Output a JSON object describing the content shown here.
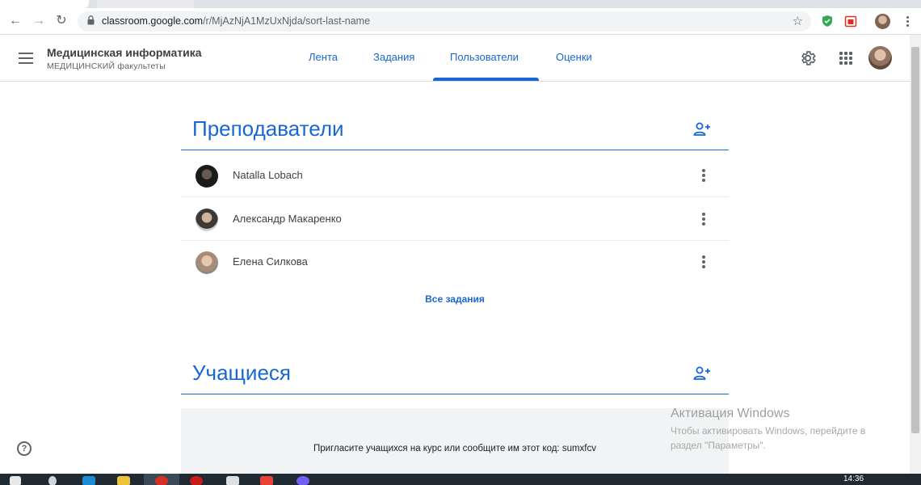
{
  "browser": {
    "url_host": "classroom.google.com",
    "url_path": "/r/MjAzNjA1MzUxNjda/sort-last-name"
  },
  "header": {
    "course_title": "Медицинская информатика",
    "course_subtitle": "МЕДИЦИНСКИЙ факультеты",
    "tabs": [
      {
        "label": "Лента",
        "active": false
      },
      {
        "label": "Задания",
        "active": false
      },
      {
        "label": "Пользователи",
        "active": true
      },
      {
        "label": "Оценки",
        "active": false
      }
    ]
  },
  "teachers": {
    "title": "Преподаватели",
    "people": [
      {
        "name": "Natalla Lobach"
      },
      {
        "name": "Александр Макаренко"
      },
      {
        "name": "Елена Силкова"
      }
    ],
    "all_link": "Все задания"
  },
  "students": {
    "title": "Учащиеся",
    "invite_text": "Пригласите учащихся на курс или сообщите им этот код: sumxfcv"
  },
  "watermark": {
    "title": "Активация Windows",
    "line1": "Чтобы активировать Windows, перейдите в",
    "line2": "раздел \"Параметры\"."
  },
  "taskbar": {
    "clock": "14:36"
  },
  "colors": {
    "accent": "#1967d2",
    "text": "#3c4043",
    "divider": "#dadce0"
  }
}
